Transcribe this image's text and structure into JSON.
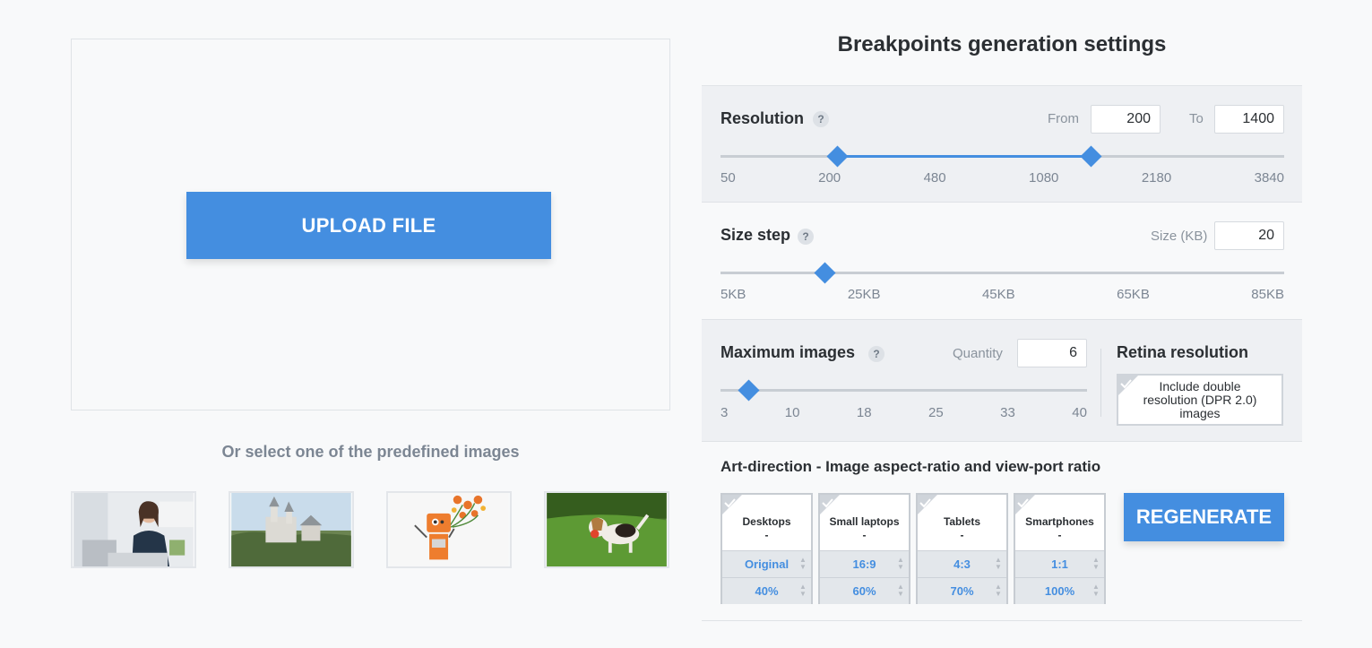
{
  "upload": {
    "button_label": "UPLOAD FILE"
  },
  "predefined": {
    "label": "Or select one of the predefined images",
    "images": [
      {
        "icon": "woman-at-laptop-image"
      },
      {
        "icon": "castle-landscape-image"
      },
      {
        "icon": "robot-with-flowers-image"
      },
      {
        "icon": "puppy-on-grass-image"
      }
    ]
  },
  "settings": {
    "title": "Breakpoints generation settings",
    "resolution": {
      "title": "Resolution",
      "help": "?",
      "from_label": "From",
      "from_value": "200",
      "to_label": "To",
      "to_value": "1400",
      "ticks": [
        "50",
        "200",
        "480",
        "1080",
        "2180",
        "3840"
      ]
    },
    "size_step": {
      "title": "Size step",
      "help": "?",
      "size_label": "Size (KB)",
      "size_value": "20",
      "ticks": [
        "5KB",
        "25KB",
        "45KB",
        "65KB",
        "85KB"
      ]
    },
    "max_images": {
      "title": "Maximum images",
      "help": "?",
      "quantity_label": "Quantity",
      "quantity_value": "6",
      "ticks": [
        "3",
        "10",
        "18",
        "25",
        "33",
        "40"
      ]
    },
    "retina": {
      "title": "Retina resolution",
      "checkbox_label": "Include double resolution (DPR 2.0) images"
    },
    "art_direction": {
      "title": "Art-direction - Image aspect-ratio and view-port ratio",
      "devices": [
        {
          "name": "Desktops",
          "dash": "-",
          "ratio": "Original",
          "viewport": "40%"
        },
        {
          "name": "Small laptops",
          "dash": "-",
          "ratio": "16:9",
          "viewport": "60%"
        },
        {
          "name": "Tablets",
          "dash": "-",
          "ratio": "4:3",
          "viewport": "70%"
        },
        {
          "name": "Smartphones",
          "dash": "-",
          "ratio": "1:1",
          "viewport": "100%"
        }
      ],
      "regenerate_label": "REGENERATE"
    }
  },
  "colors": {
    "accent": "#448ee0",
    "panel_gray": "#eef0f3",
    "muted_text": "#7c8693"
  }
}
